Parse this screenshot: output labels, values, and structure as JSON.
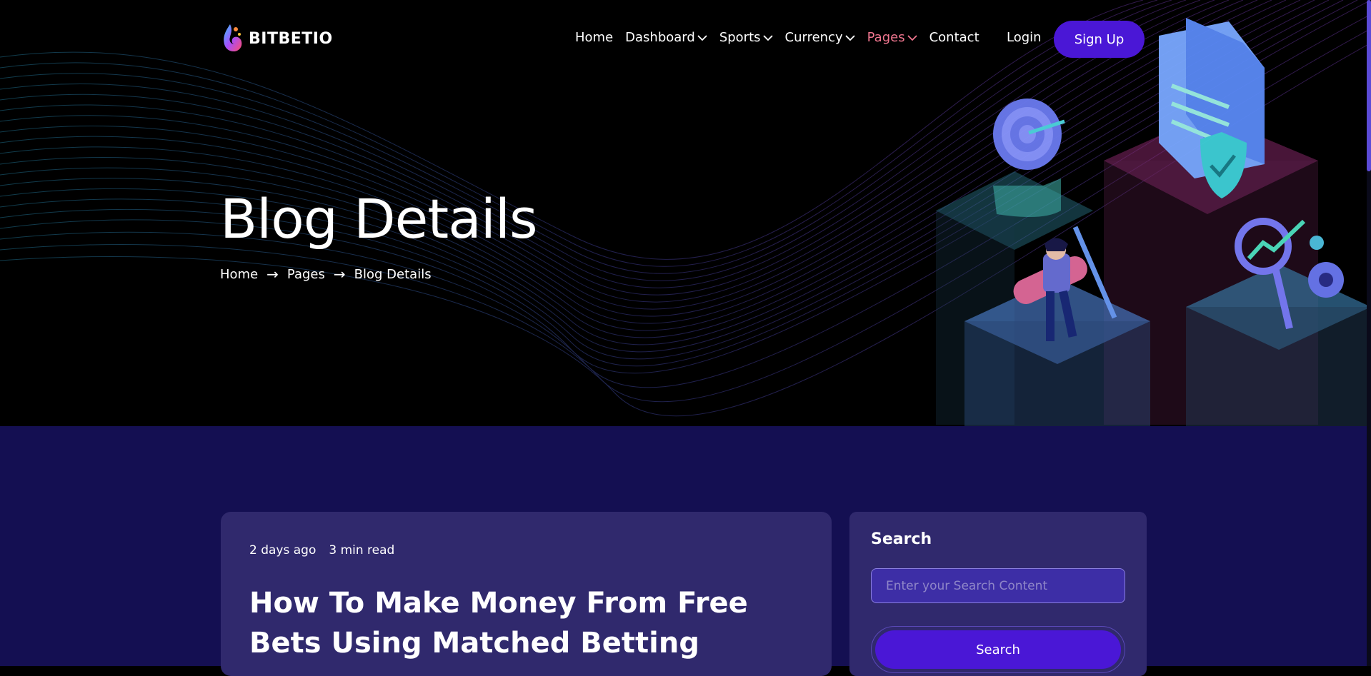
{
  "brand": {
    "name": "BITBETIO"
  },
  "nav": {
    "items": [
      {
        "label": "Home",
        "dropdown": false,
        "active": false
      },
      {
        "label": "Dashboard",
        "dropdown": true,
        "active": false
      },
      {
        "label": "Sports",
        "dropdown": true,
        "active": false
      },
      {
        "label": "Currency",
        "dropdown": true,
        "active": false
      },
      {
        "label": "Pages",
        "dropdown": true,
        "active": true
      },
      {
        "label": "Contact",
        "dropdown": false,
        "active": false
      }
    ],
    "login_label": "Login",
    "signup_label": "Sign Up"
  },
  "hero": {
    "title": "Blog Details",
    "breadcrumb": [
      "Home",
      "Pages",
      "Blog Details"
    ]
  },
  "post": {
    "posted": "2 days ago",
    "read_time": "3 min read",
    "title": "How To Make Money From Free Bets Using Matched Betting"
  },
  "sidebar": {
    "search_title": "Search",
    "search_placeholder": "Enter your Search Content",
    "search_button": "Search"
  },
  "colors": {
    "accent": "#4a17d6",
    "active_nav": "#f0768f",
    "page_bg": "#140f52",
    "card_bg": "#30296d"
  }
}
